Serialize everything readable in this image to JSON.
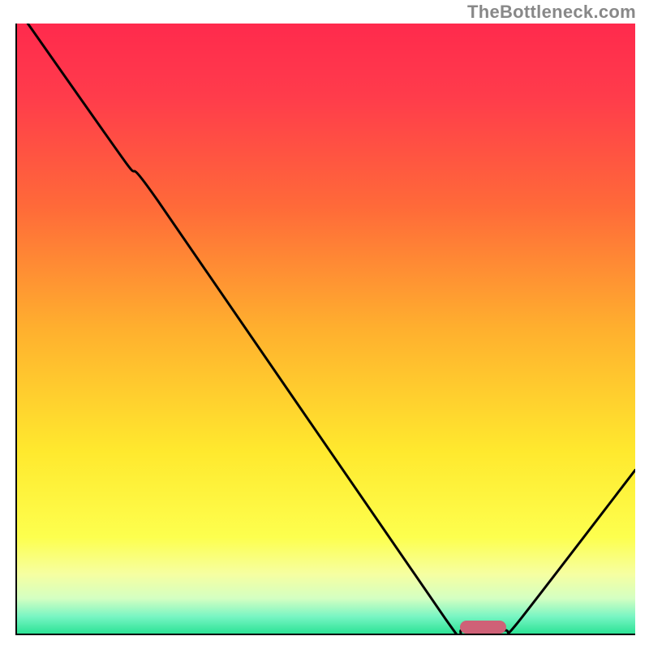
{
  "attribution": "TheBottleneck.com",
  "chart_data": {
    "type": "line",
    "title": "",
    "xlabel": "",
    "ylabel": "",
    "xlim": [
      0,
      1
    ],
    "ylim": [
      0,
      1
    ],
    "background_gradient_stops": [
      {
        "offset": 0.0,
        "color": "#ff2a4d"
      },
      {
        "offset": 0.12,
        "color": "#ff3c4b"
      },
      {
        "offset": 0.3,
        "color": "#ff6a39"
      },
      {
        "offset": 0.5,
        "color": "#ffb02e"
      },
      {
        "offset": 0.7,
        "color": "#ffe92e"
      },
      {
        "offset": 0.84,
        "color": "#fdff4e"
      },
      {
        "offset": 0.9,
        "color": "#f6ffa1"
      },
      {
        "offset": 0.94,
        "color": "#d4ffc2"
      },
      {
        "offset": 0.97,
        "color": "#77f5c3"
      },
      {
        "offset": 1.0,
        "color": "#25e191"
      }
    ],
    "series": [
      {
        "name": "bottleneck-curve",
        "points": [
          {
            "x": 0.02,
            "y": 1.0
          },
          {
            "x": 0.18,
            "y": 0.77
          },
          {
            "x": 0.23,
            "y": 0.71
          },
          {
            "x": 0.695,
            "y": 0.025
          },
          {
            "x": 0.72,
            "y": 0.008
          },
          {
            "x": 0.79,
            "y": 0.008
          },
          {
            "x": 0.81,
            "y": 0.02
          },
          {
            "x": 1.0,
            "y": 0.27
          }
        ]
      }
    ],
    "marker": {
      "name": "optimal-region",
      "x_center": 0.755,
      "y_center": 0.013,
      "width": 0.075,
      "height": 0.022,
      "color": "#cf6177"
    }
  }
}
